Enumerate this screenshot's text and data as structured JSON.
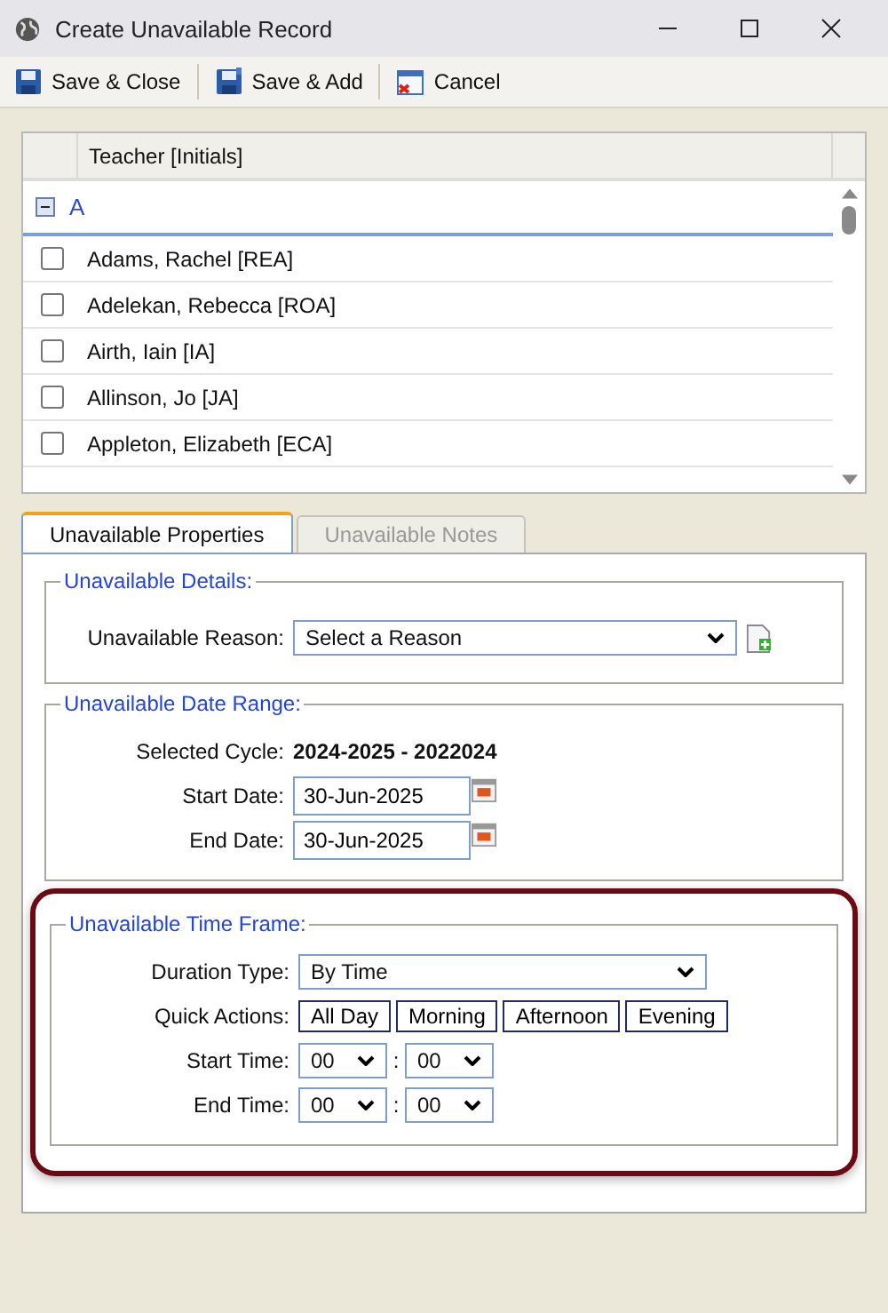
{
  "window": {
    "title": "Create Unavailable Record"
  },
  "toolbar": [
    {
      "kind": "save",
      "label": "Save & Close"
    },
    {
      "kind": "save_add",
      "label": "Save & Add"
    },
    {
      "kind": "cancel",
      "label": "Cancel"
    }
  ],
  "teacher_list": {
    "column_header": "Teacher [Initials]",
    "group": {
      "label": "A",
      "expanded": true
    },
    "rows": [
      {
        "name": "Adams, Rachel [REA]",
        "checked": false
      },
      {
        "name": "Adelekan, Rebecca [ROA]",
        "checked": false
      },
      {
        "name": "Airth, Iain [IA]",
        "checked": false
      },
      {
        "name": "Allinson, Jo [JA]",
        "checked": false
      },
      {
        "name": "Appleton, Elizabeth [ECA]",
        "checked": false
      }
    ]
  },
  "tabs": [
    {
      "label": "Unavailable Properties",
      "selected": true
    },
    {
      "label": "Unavailable Notes",
      "selected": false
    }
  ],
  "details": {
    "legend": "Unavailable Details:",
    "reason_label": "Unavailable Reason:",
    "reason_value": "Select a Reason"
  },
  "date_range": {
    "legend": "Unavailable Date Range:",
    "cycle_label": "Selected Cycle:",
    "cycle_value": "2024-2025 - 2022024",
    "start_label": "Start Date:",
    "start_value": "30-Jun-2025",
    "end_label": "End Date:",
    "end_value": "30-Jun-2025"
  },
  "time_frame": {
    "legend": "Unavailable Time Frame:",
    "highlighted": true,
    "duration_label": "Duration Type:",
    "duration_value": "By Time",
    "quick_label": "Quick Actions:",
    "quick_actions": [
      "All Day",
      "Morning",
      "Afternoon",
      "Evening"
    ],
    "times": [
      {
        "label": "Start Time:",
        "hour": "00",
        "separator": ":",
        "minute": "00"
      },
      {
        "label": "End Time:",
        "hour": "00",
        "separator": ":",
        "minute": "00"
      }
    ]
  }
}
